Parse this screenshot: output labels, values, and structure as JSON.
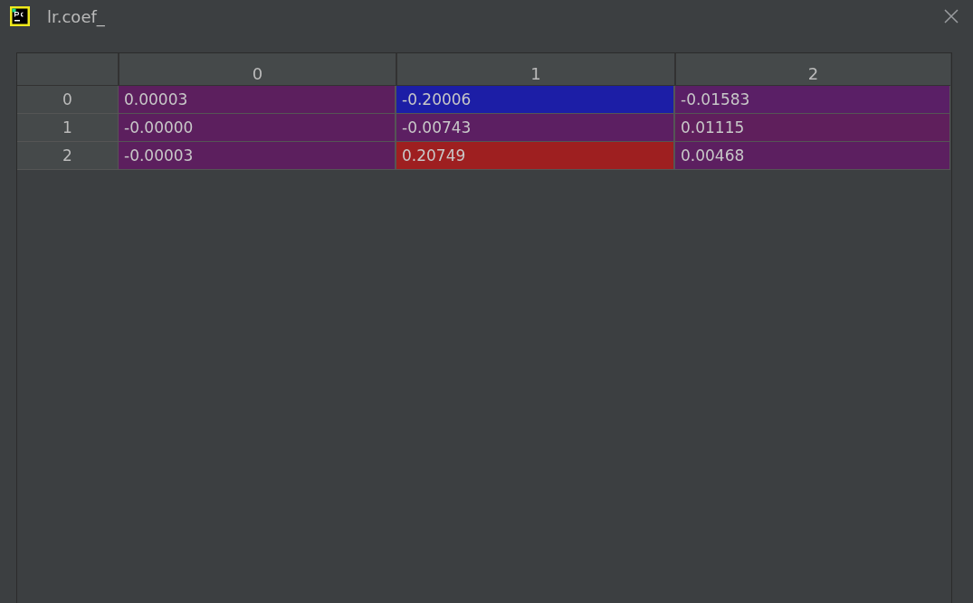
{
  "window": {
    "title": "lr.coef_"
  },
  "table": {
    "columns": [
      "0",
      "1",
      "2"
    ],
    "rows": [
      {
        "index": "0",
        "cells": [
          {
            "text": "0.00003",
            "color": "#5c1f5e"
          },
          {
            "text": "-0.20006",
            "color": "#1c1ea6"
          },
          {
            "text": "-0.01583",
            "color": "#5a1f66"
          }
        ]
      },
      {
        "index": "1",
        "cells": [
          {
            "text": "-0.00000",
            "color": "#5c1f5e"
          },
          {
            "text": "-0.00743",
            "color": "#5c1f62"
          },
          {
            "text": "0.01115",
            "color": "#5f1f5c"
          }
        ]
      },
      {
        "index": "2",
        "cells": [
          {
            "text": "-0.00003",
            "color": "#5c1f5e"
          },
          {
            "text": "0.20749",
            "color": "#9e1f20"
          },
          {
            "text": "0.00468",
            "color": "#5c1f60"
          }
        ]
      }
    ]
  }
}
